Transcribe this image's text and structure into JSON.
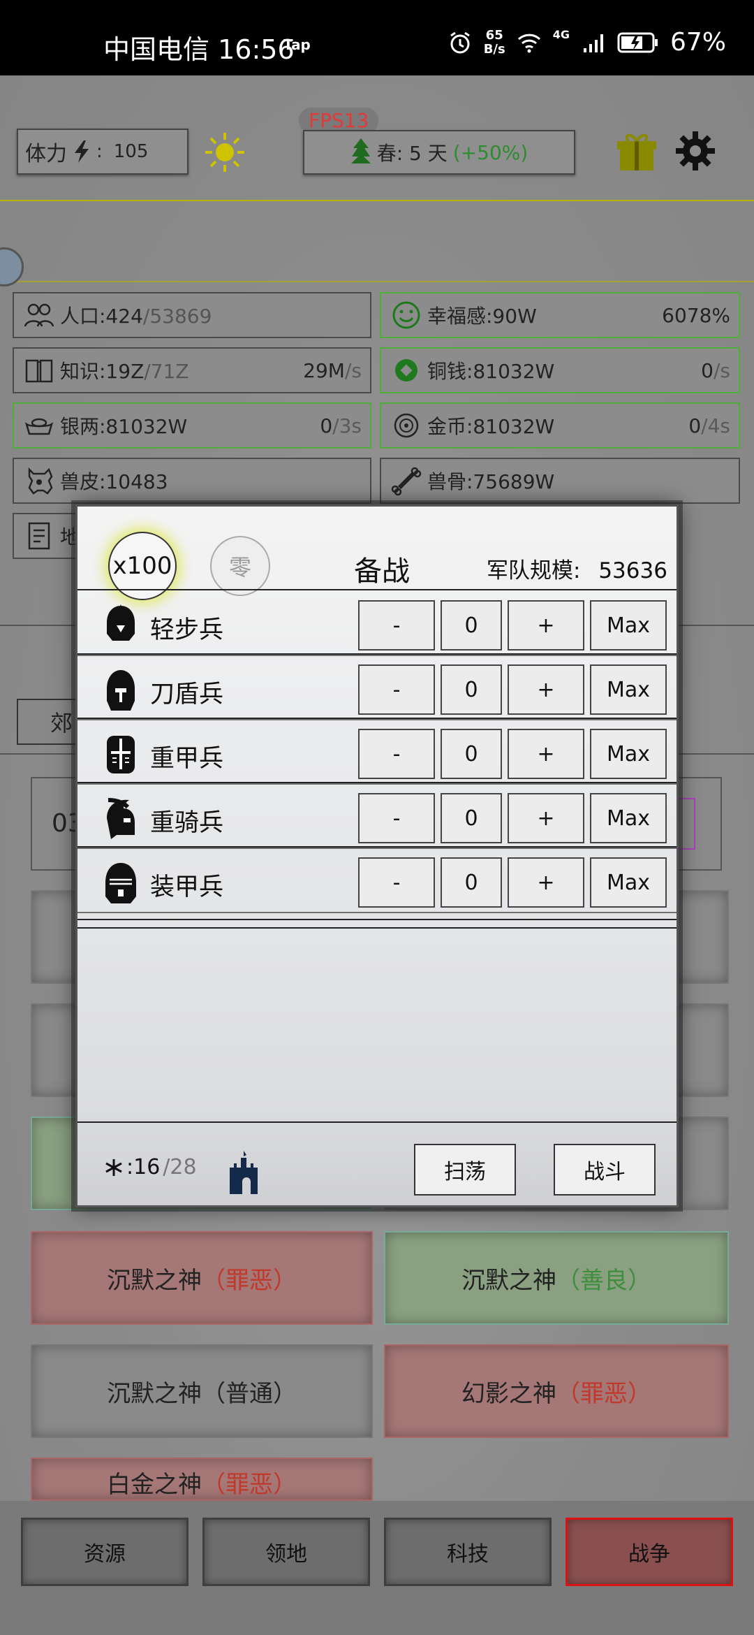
{
  "status_bar": {
    "carrier": "中国电信",
    "time": "16:56",
    "tap": "Tap",
    "net_speed_value": "65",
    "net_speed_unit": "B/s",
    "network": "4G",
    "battery": "67%"
  },
  "top_bar": {
    "stamina_label": "体力",
    "stamina_sep": ":",
    "stamina_value": "105",
    "fps": "FPS13",
    "season": "春: 5 天",
    "season_bonus": "(+50%)"
  },
  "resources": [
    {
      "label": "人口:424",
      "suffix": "/53869",
      "rate": "",
      "rate_unit": "",
      "highlight": false,
      "icon": "people-icon"
    },
    {
      "label": "幸福感:90W",
      "suffix": "",
      "rate": "6078%",
      "rate_unit": "",
      "highlight": true,
      "icon": "smile-icon"
    },
    {
      "label": "知识:19Z",
      "suffix": "/71Z",
      "rate": "29M",
      "rate_unit": "/s",
      "highlight": false,
      "icon": "book-icon"
    },
    {
      "label": "铜钱:81032W",
      "suffix": "",
      "rate": "0",
      "rate_unit": "/s",
      "highlight": true,
      "icon": "coin-icon"
    },
    {
      "label": "银两:81032W",
      "suffix": "",
      "rate": "0",
      "rate_unit": "/3s",
      "highlight": true,
      "icon": "silver-ingot-icon"
    },
    {
      "label": "金币:81032W",
      "suffix": "",
      "rate": "0",
      "rate_unit": "/4s",
      "highlight": true,
      "icon": "gold-coin-icon"
    },
    {
      "label": "兽皮:10483",
      "suffix": "",
      "rate": "",
      "rate_unit": "",
      "highlight": false,
      "icon": "hide-icon"
    },
    {
      "label": "兽骨:75689W",
      "suffix": "",
      "rate": "",
      "rate_unit": "",
      "highlight": false,
      "icon": "bone-icon"
    },
    {
      "label": "地",
      "suffix": "",
      "rate": "",
      "rate_unit": "",
      "highlight": false,
      "icon": "document-icon"
    }
  ],
  "partial": {
    "tab_label": "郊",
    "row_label": "03"
  },
  "gods": [
    {
      "name": "沉默之神",
      "tag": "（罪恶）",
      "tag_color": "#c0392b",
      "style": "red"
    },
    {
      "name": "沉默之神",
      "tag": "（善良）",
      "tag_color": "#3e8e3e",
      "style": "green"
    },
    {
      "name": "沉默之神",
      "tag": "（普通）",
      "tag_color": "#222222",
      "style": "grey"
    },
    {
      "name": "幻影之神",
      "tag": "（罪恶）",
      "tag_color": "#c0392b",
      "style": "red"
    },
    {
      "name": "白金之神",
      "tag": "（罪恶）",
      "tag_color": "#c0392b",
      "style": "red"
    }
  ],
  "modal": {
    "multiplier": "x100",
    "zero": "零",
    "title": "备战",
    "army_label": "军队规模:",
    "army_size": "53636",
    "units": [
      {
        "name": "轻步兵",
        "count": "0",
        "icon": "light-infantry-helmet-icon"
      },
      {
        "name": "刀盾兵",
        "count": "0",
        "icon": "sword-shield-helmet-icon"
      },
      {
        "name": "重甲兵",
        "count": "0",
        "icon": "heavy-armor-helmet-icon"
      },
      {
        "name": "重骑兵",
        "count": "0",
        "icon": "cavalry-helmet-icon"
      },
      {
        "name": "装甲兵",
        "count": "0",
        "icon": "armored-helmet-icon"
      }
    ],
    "minus": "-",
    "plus": "+",
    "max": "Max",
    "stamina_cur": ":16",
    "stamina_max": "/28",
    "sweep": "扫荡",
    "fight": "战斗"
  },
  "nav": {
    "resources": "资源",
    "territory": "领地",
    "tech": "科技",
    "war": "战争"
  }
}
